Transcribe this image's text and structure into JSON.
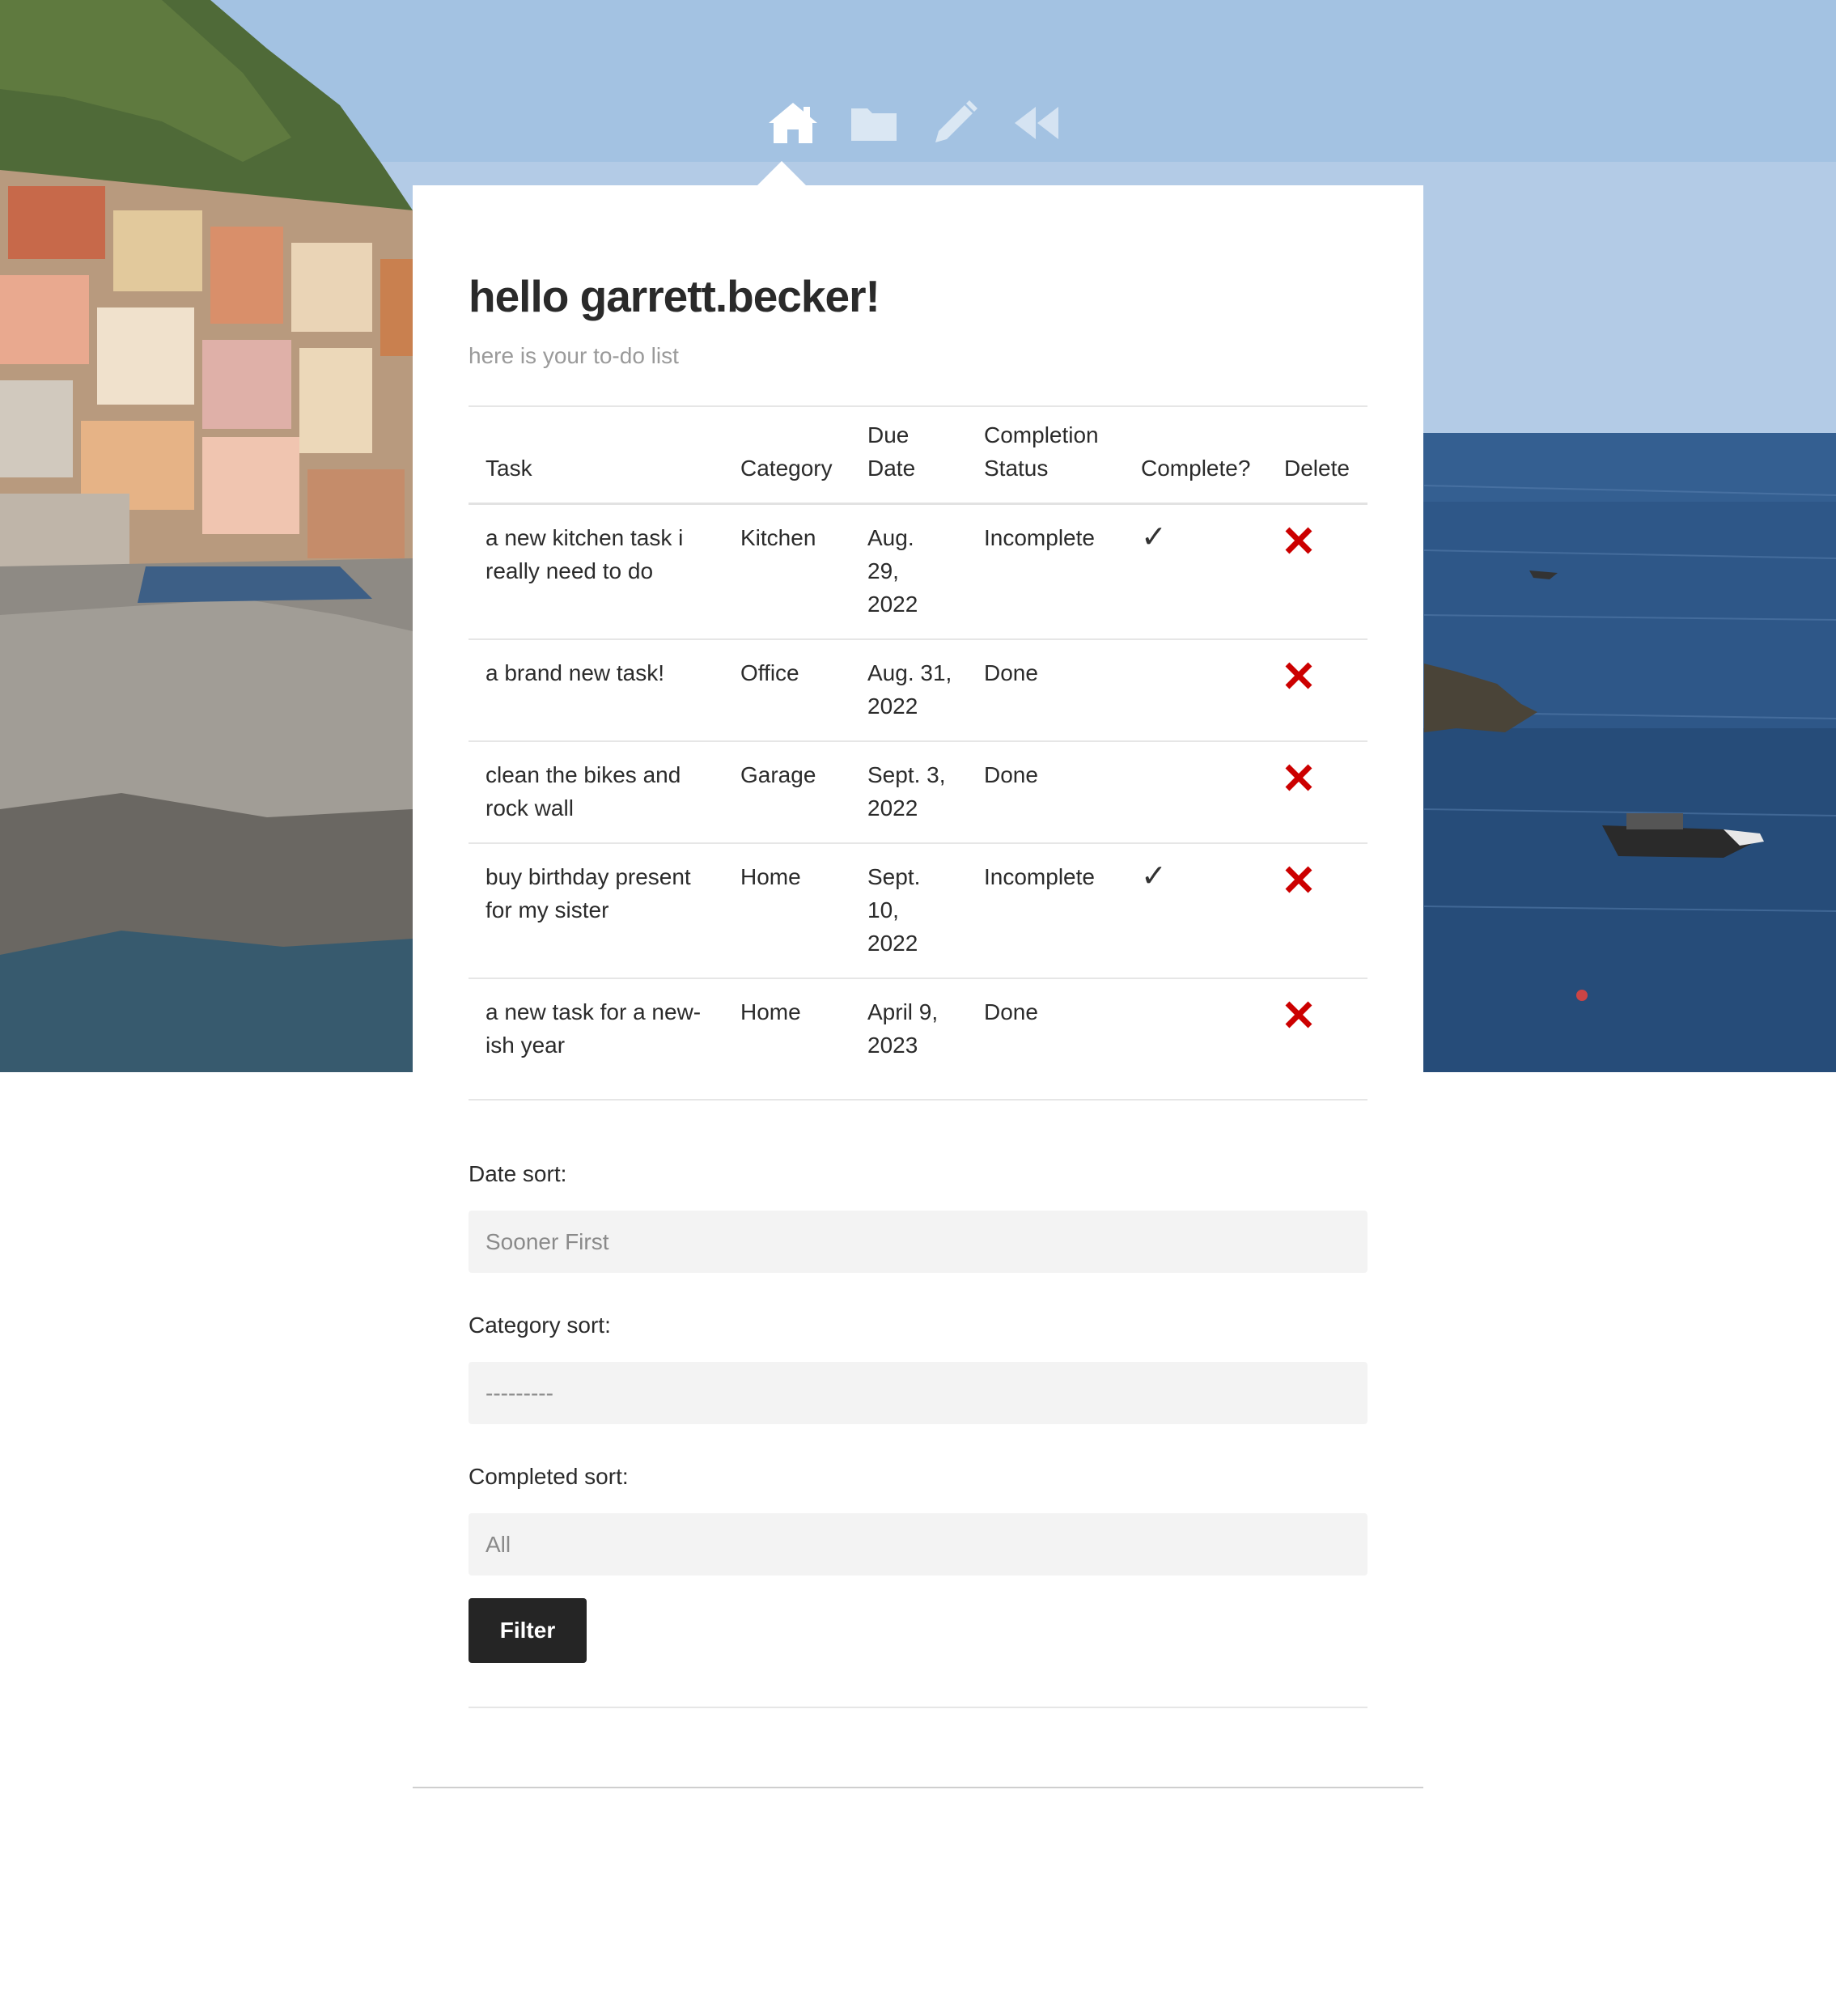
{
  "nav": {
    "items": [
      {
        "name": "home",
        "icon": "home-icon",
        "active": true
      },
      {
        "name": "folder",
        "icon": "folder-icon",
        "active": false
      },
      {
        "name": "edit",
        "icon": "pencil-icon",
        "active": false
      },
      {
        "name": "back",
        "icon": "rewind-icon",
        "active": false
      }
    ]
  },
  "header": {
    "title": "hello garrett.becker!",
    "subtitle": "here is your to-do list"
  },
  "table": {
    "columns": [
      "Task",
      "Category",
      "Due Date",
      "Completion Status",
      "Complete?",
      "Delete"
    ],
    "rows": [
      {
        "task": "a new kitchen task i really need to do",
        "category": "Kitchen",
        "due": "Aug. 29, 2022",
        "status": "Incomplete",
        "complete": "✓",
        "delete": "✕"
      },
      {
        "task": "a brand new task!",
        "category": "Office",
        "due": "Aug. 31, 2022",
        "status": "Done",
        "complete": "",
        "delete": "✕"
      },
      {
        "task": "clean the bikes and rock wall",
        "category": "Garage",
        "due": "Sept. 3, 2022",
        "status": "Done",
        "complete": "",
        "delete": "✕"
      },
      {
        "task": "buy birthday present for my sister",
        "category": "Home",
        "due": "Sept. 10, 2022",
        "status": "Incomplete",
        "complete": "✓",
        "delete": "✕"
      },
      {
        "task": "a new task for a new-ish year",
        "category": "Home",
        "due": "April 9, 2023",
        "status": "Done",
        "complete": "",
        "delete": "✕"
      }
    ]
  },
  "form": {
    "date_sort_label": "Date sort:",
    "date_sort_value": "Sooner First",
    "category_sort_label": "Category sort:",
    "category_sort_value": "---------",
    "completed_sort_label": "Completed sort:",
    "completed_sort_value": "All",
    "filter_label": "Filter"
  },
  "colors": {
    "delete": "#cc0000",
    "button": "#252525",
    "field_bg": "#f3f3f3"
  }
}
